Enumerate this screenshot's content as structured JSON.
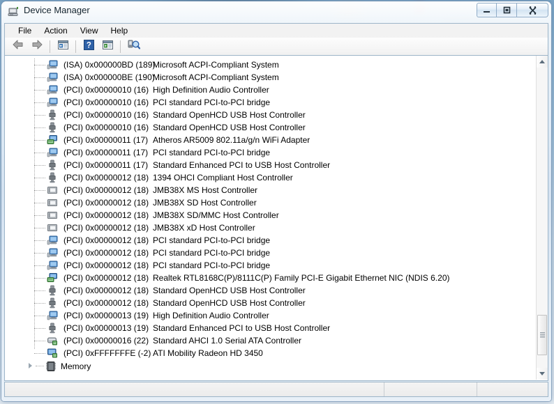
{
  "window": {
    "title": "Device Manager",
    "icon": "device-manager-icon",
    "caption_buttons": [
      {
        "name": "minimize-button",
        "glyph": "minimize"
      },
      {
        "name": "maximize-button",
        "glyph": "maximize"
      },
      {
        "name": "close-button",
        "glyph": "close"
      }
    ]
  },
  "menubar": {
    "items": [
      {
        "label": "File"
      },
      {
        "label": "Action"
      },
      {
        "label": "View"
      },
      {
        "label": "Help"
      }
    ]
  },
  "toolbar": {
    "buttons": [
      {
        "name": "back-button",
        "icon": "back-arrow-icon"
      },
      {
        "name": "forward-button",
        "icon": "forward-arrow-icon"
      },
      {
        "name": "properties-button",
        "icon": "properties-window-icon"
      },
      {
        "name": "help-button",
        "icon": "question-mark-icon"
      },
      {
        "name": "scan-button",
        "icon": "play-window-icon"
      },
      {
        "name": "scan-hardware-changes-button",
        "icon": "scan-hardware-icon"
      }
    ]
  },
  "tree": {
    "rows": [
      {
        "icon": "acpi-device-icon",
        "resource": "(ISA) 0x000000BD (189)",
        "device": "Microsoft ACPI-Compliant System"
      },
      {
        "icon": "acpi-device-icon",
        "resource": "(ISA) 0x000000BE (190)",
        "device": "Microsoft ACPI-Compliant System"
      },
      {
        "icon": "acpi-device-icon",
        "resource": "(PCI) 0x00000010 (16)",
        "device": "High Definition Audio Controller"
      },
      {
        "icon": "acpi-device-icon",
        "resource": "(PCI) 0x00000010 (16)",
        "device": "PCI standard PCI-to-PCI bridge"
      },
      {
        "icon": "usb-device-icon",
        "resource": "(PCI) 0x00000010 (16)",
        "device": "Standard OpenHCD USB Host Controller"
      },
      {
        "icon": "usb-device-icon",
        "resource": "(PCI) 0x00000010 (16)",
        "device": "Standard OpenHCD USB Host Controller"
      },
      {
        "icon": "network-device-icon",
        "resource": "(PCI) 0x00000011 (17)",
        "device": "Atheros AR5009 802.11a/g/n WiFi Adapter"
      },
      {
        "icon": "acpi-device-icon",
        "resource": "(PCI) 0x00000011 (17)",
        "device": "PCI standard PCI-to-PCI bridge"
      },
      {
        "icon": "usb-device-icon",
        "resource": "(PCI) 0x00000011 (17)",
        "device": "Standard Enhanced PCI to USB Host Controller"
      },
      {
        "icon": "usb-device-icon",
        "resource": "(PCI) 0x00000012 (18)",
        "device": "1394 OHCI Compliant Host Controller"
      },
      {
        "icon": "card-reader-icon",
        "resource": "(PCI) 0x00000012 (18)",
        "device": "JMB38X MS Host Controller"
      },
      {
        "icon": "card-reader-icon",
        "resource": "(PCI) 0x00000012 (18)",
        "device": "JMB38X SD Host Controller"
      },
      {
        "icon": "card-reader-icon",
        "resource": "(PCI) 0x00000012 (18)",
        "device": "JMB38X SD/MMC Host Controller"
      },
      {
        "icon": "card-reader-icon",
        "resource": "(PCI) 0x00000012 (18)",
        "device": "JMB38X xD Host Controller"
      },
      {
        "icon": "acpi-device-icon",
        "resource": "(PCI) 0x00000012 (18)",
        "device": "PCI standard PCI-to-PCI bridge"
      },
      {
        "icon": "acpi-device-icon",
        "resource": "(PCI) 0x00000012 (18)",
        "device": "PCI standard PCI-to-PCI bridge"
      },
      {
        "icon": "acpi-device-icon",
        "resource": "(PCI) 0x00000012 (18)",
        "device": "PCI standard PCI-to-PCI bridge"
      },
      {
        "icon": "network-device-icon",
        "resource": "(PCI) 0x00000012 (18)",
        "device": "Realtek RTL8168C(P)/8111C(P) Family PCI-E Gigabit Ethernet NIC (NDIS 6.20)"
      },
      {
        "icon": "usb-device-icon",
        "resource": "(PCI) 0x00000012 (18)",
        "device": "Standard OpenHCD USB Host Controller"
      },
      {
        "icon": "usb-device-icon",
        "resource": "(PCI) 0x00000012 (18)",
        "device": "Standard OpenHCD USB Host Controller"
      },
      {
        "icon": "acpi-device-icon",
        "resource": "(PCI) 0x00000013 (19)",
        "device": "High Definition Audio Controller"
      },
      {
        "icon": "usb-device-icon",
        "resource": "(PCI) 0x00000013 (19)",
        "device": "Standard Enhanced PCI to USB Host Controller"
      },
      {
        "icon": "storage-device-icon",
        "resource": "(PCI) 0x00000016 (22)",
        "device": "Standard AHCI 1.0 Serial ATA Controller"
      },
      {
        "icon": "display-device-icon",
        "resource": "(PCI) 0xFFFFFFFE (-2)",
        "device": "ATI Mobility Radeon HD 3450"
      }
    ],
    "root_node": {
      "label": "Memory",
      "icon": "memory-chip-icon",
      "expander": "collapsed-triangle-icon"
    }
  },
  "scrollbar": {
    "up_arrow": "scroll-up-icon",
    "down_arrow": "scroll-down-icon",
    "thumb": "scroll-thumb"
  },
  "statusbar": {
    "main": "",
    "segment2": "",
    "segment3": ""
  },
  "colors": {
    "accent": "#2c5d8f",
    "window_glass": "#dce8f4",
    "list_background": "#ffffff",
    "text": "#000000",
    "tree_line": "#a8a8a8"
  }
}
